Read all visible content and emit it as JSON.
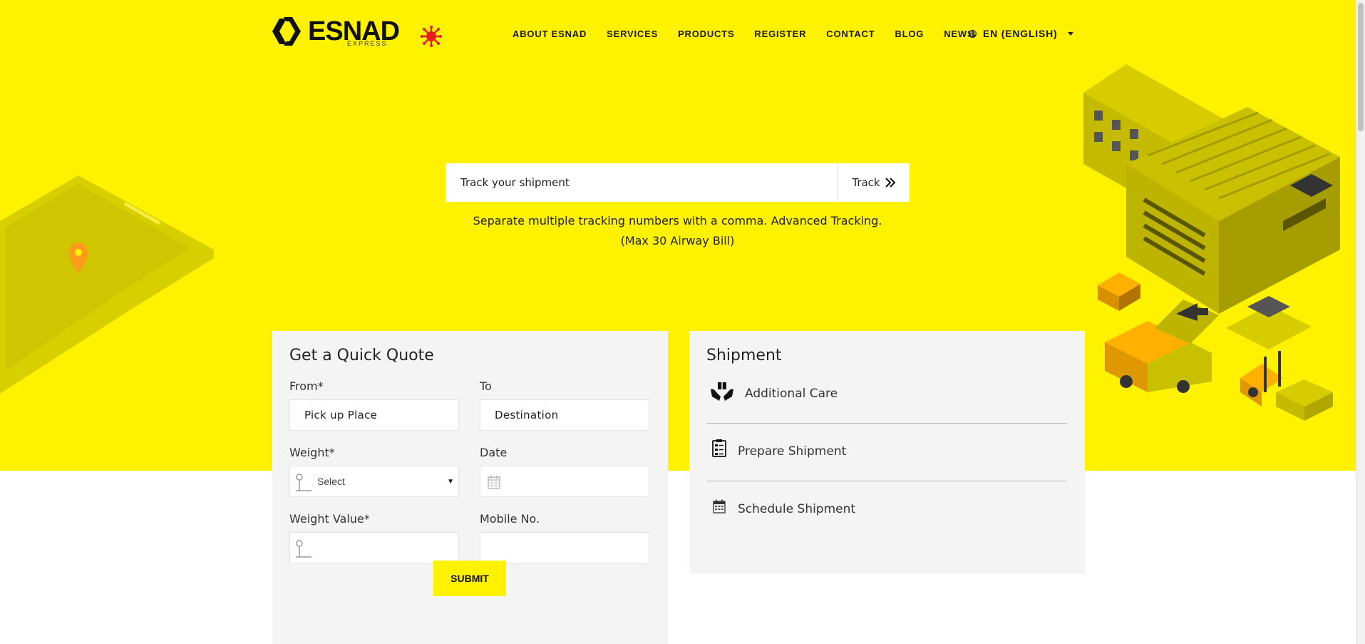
{
  "header": {
    "logo_text": "ESNAD",
    "logo_sub": "EXPRESS",
    "nav": [
      "ABOUT ESNAD",
      "SERVICES",
      "PRODUCTS",
      "REGISTER",
      "CONTACT",
      "BLOG",
      "NEWS"
    ],
    "language": "EN (ENGLISH)"
  },
  "tracking": {
    "placeholder": "Track your shipment",
    "button_label": "Track",
    "note_line1": "Separate multiple tracking numbers with a comma. Advanced Tracking.",
    "note_line2": "(Max 30 Airway Bill)"
  },
  "quote": {
    "title": "Get a Quick Quote",
    "from_label": "From*",
    "from_placeholder": "Pick up Place",
    "to_label": "To",
    "to_placeholder": "Destination",
    "weight_label": "Weight*",
    "weight_value": "Select",
    "date_label": "Date",
    "weight_value_label": "Weight Value*",
    "mobile_label": "Mobile No.",
    "submit_label": "SUBMIT"
  },
  "shipment": {
    "title": "Shipment",
    "items": [
      "Additional Care",
      "Prepare Shipment",
      "Schedule Shipment"
    ]
  },
  "colors": {
    "brand_yellow": "#fff200",
    "panel_bg": "#f4f4f4"
  },
  "icons": [
    "logo-chevron-icon",
    "covid-virus-icon",
    "globe-icon",
    "double-chevron-right-icon",
    "pin-icon",
    "calendar-icon",
    "hands-box-icon",
    "clipboard-icon"
  ]
}
